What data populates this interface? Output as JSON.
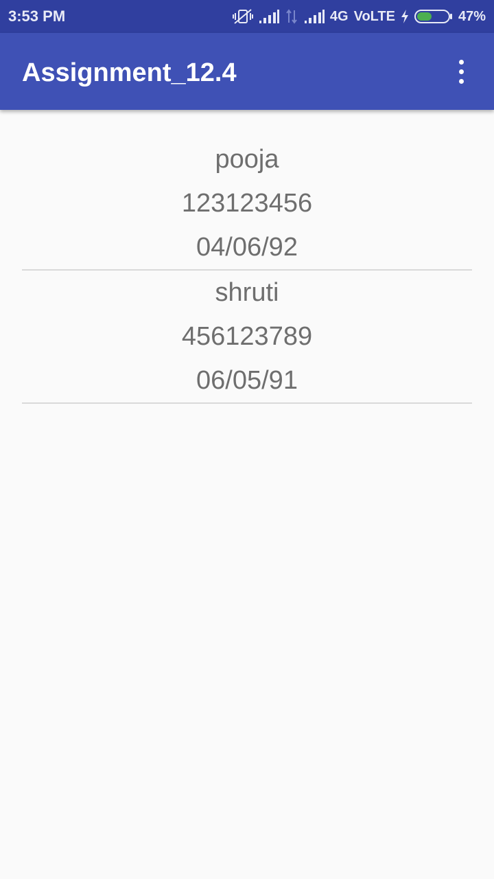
{
  "status_bar": {
    "time": "3:53 PM",
    "network": "4G",
    "volte": "VoLTE",
    "battery": "47%",
    "battery_level": 0.47,
    "icons": [
      "vibrate-off-icon",
      "signal-icon",
      "data-arrows-icon",
      "signal-icon",
      "charging-icon",
      "battery-icon"
    ]
  },
  "app_bar": {
    "title": "Assignment_12.4",
    "menu_icon": "more-vert-icon"
  },
  "contacts": [
    {
      "name": "pooja",
      "phone": "123123456",
      "dob": "04/06/92"
    },
    {
      "name": "shruti",
      "phone": "456123789",
      "dob": "06/05/91"
    }
  ],
  "colors": {
    "status_bar": "#303f9f",
    "app_bar": "#3f51b5",
    "background": "#fafafa",
    "text": "#6e6e6e",
    "divider": "#d9d9d9",
    "battery_fill": "#4caf50"
  }
}
